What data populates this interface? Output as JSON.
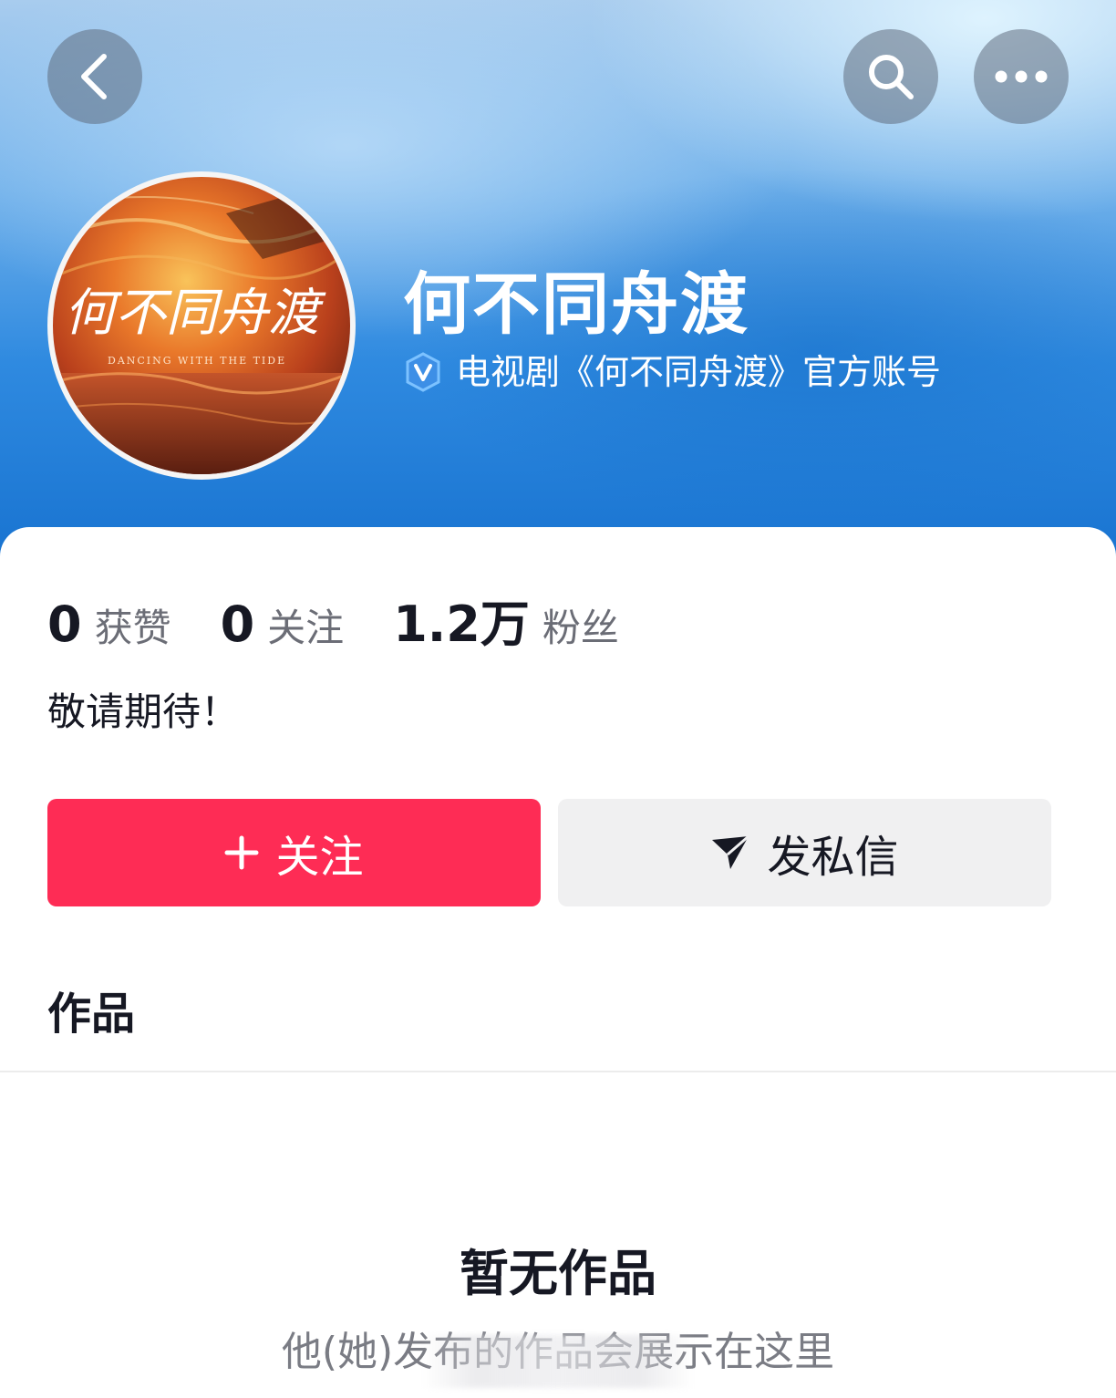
{
  "header": {
    "buttons": {
      "back_icon": "chevron-left-icon",
      "search_icon": "search-icon",
      "more_icon": "more-dots-icon"
    },
    "avatar": {
      "lettering": "何不同舟渡",
      "english_lettering": "DANCING WITH THE TIDE"
    }
  },
  "profile": {
    "name": "何不同舟渡",
    "verification": "电视剧《何不同舟渡》官方账号",
    "verify_icon": "verified-v-icon"
  },
  "stats": [
    {
      "value": "0",
      "label": "获赞"
    },
    {
      "value": "0",
      "label": "关注"
    },
    {
      "value": "1.2万",
      "label": "粉丝"
    }
  ],
  "bio": "敬请期待！",
  "actions": {
    "follow_label": "关注",
    "message_label": "发私信"
  },
  "tabs": {
    "works_label": "作品"
  },
  "empty_state": {
    "title": "暂无作品",
    "description": "他(她)发布的作品会展示在这里"
  },
  "colors": {
    "follow_button": "#fe2c55",
    "message_button": "#f0f0f1",
    "header_blue": "#1671cf",
    "verify_badge": "#63b9ff"
  }
}
